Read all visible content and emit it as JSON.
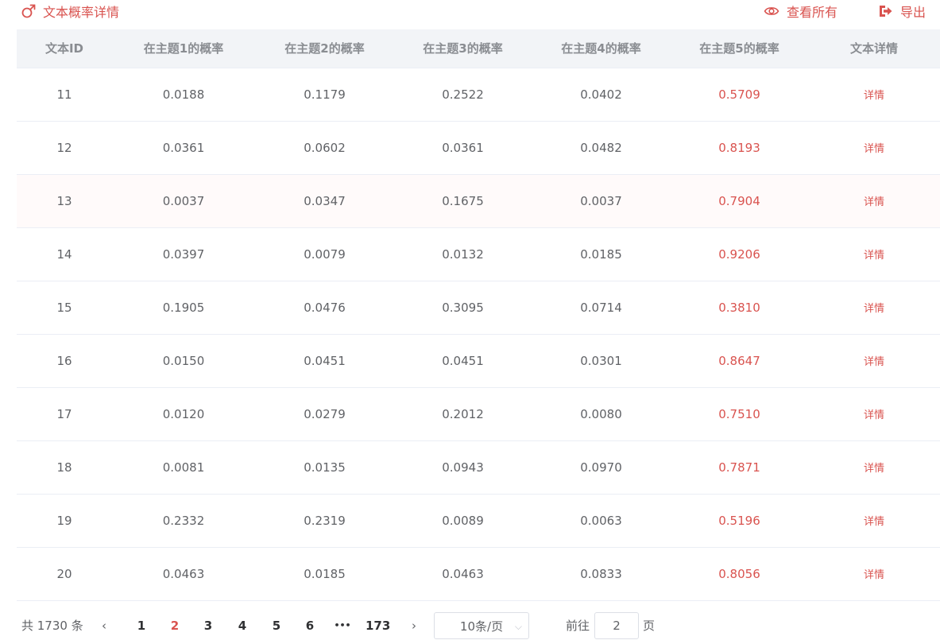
{
  "header": {
    "title": "文本概率详情",
    "view_all": "查看所有",
    "export": "导出"
  },
  "table": {
    "columns": [
      "文本ID",
      "在主题1的概率",
      "在主题2的概率",
      "在主题3的概率",
      "在主题4的概率",
      "在主题5的概率",
      "文本详情"
    ],
    "detail_label": "详情",
    "rows": [
      [
        "11",
        "0.0188",
        "0.1179",
        "0.2522",
        "0.0402",
        "0.5709"
      ],
      [
        "12",
        "0.0361",
        "0.0602",
        "0.0361",
        "0.0482",
        "0.8193"
      ],
      [
        "13",
        "0.0037",
        "0.0347",
        "0.1675",
        "0.0037",
        "0.7904"
      ],
      [
        "14",
        "0.0397",
        "0.0079",
        "0.0132",
        "0.0185",
        "0.9206"
      ],
      [
        "15",
        "0.1905",
        "0.0476",
        "0.3095",
        "0.0714",
        "0.3810"
      ],
      [
        "16",
        "0.0150",
        "0.0451",
        "0.0451",
        "0.0301",
        "0.8647"
      ],
      [
        "17",
        "0.0120",
        "0.0279",
        "0.2012",
        "0.0080",
        "0.7510"
      ],
      [
        "18",
        "0.0081",
        "0.0135",
        "0.0943",
        "0.0970",
        "0.7871"
      ],
      [
        "19",
        "0.2332",
        "0.2319",
        "0.0089",
        "0.0063",
        "0.5196"
      ],
      [
        "20",
        "0.0463",
        "0.0185",
        "0.0463",
        "0.0833",
        "0.8056"
      ]
    ]
  },
  "pagination": {
    "total": "共 1730 条",
    "prev": "‹",
    "next": "›",
    "pages": [
      "1",
      "2",
      "3",
      "4",
      "5",
      "6",
      "•••",
      "173"
    ],
    "current": "2",
    "page_size": "10条/页",
    "goto_label": "前往",
    "goto_value": "2",
    "goto_suffix": "页"
  },
  "colors": {
    "accent": "#d9534f",
    "header_bg": "#f2f4f7",
    "text": "#606266"
  },
  "icons": {
    "title": "male-symbol-icon",
    "view_all": "eye-icon",
    "export": "sign-out-icon"
  }
}
